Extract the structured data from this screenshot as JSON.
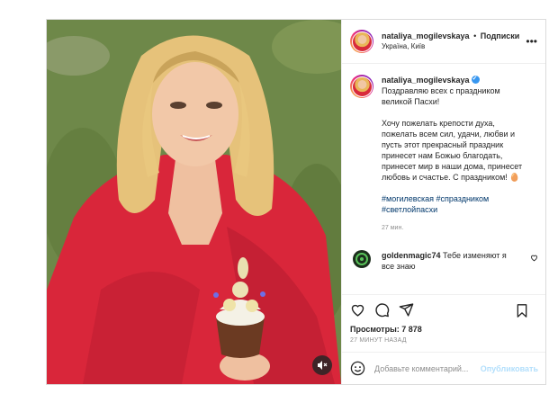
{
  "post": {
    "username": "nataliya_mogilevskaya",
    "separator": "•",
    "follow_label": "Подписки",
    "location": "Україна, Київ",
    "more_label": "•••"
  },
  "caption": {
    "username": "nataliya_mogilevskaya",
    "line1": "Поздравляю всех с праздником великой Пасхи!",
    "line2": "Хочу пожелать крепости духа, пожелать всем сил, удачи, любви и пусть этот прекрасный праздник принесет нам Божью благодать, принесет мир в наши дома, принесет любовь и счастье. С праздником! 🥚",
    "tags": [
      "#могилевская",
      "#спраздником",
      "#светлойпасхи"
    ],
    "time": "27 мин."
  },
  "comment": {
    "username": "goldenmagic74",
    "text": "Тебе изменяют я все знаю"
  },
  "stats": {
    "views_label": "Просмотры:",
    "views_value": "7 878",
    "ago": "27 МИНУТ НАЗАД"
  },
  "add_comment": {
    "placeholder": "Добавьте комментарий...",
    "publish_label": "Опубликовать"
  },
  "icons": {
    "like": "heart-icon",
    "comment": "comment-icon",
    "share": "send-icon",
    "save": "bookmark-icon",
    "emoji": "smile-icon",
    "mute": "speaker-muted-icon",
    "more": "more-options-icon"
  },
  "colors": {
    "link": "#00376b",
    "verified": "#3897f0",
    "publish_disabled": "#b2dffc",
    "dress": "#d92a3b"
  }
}
